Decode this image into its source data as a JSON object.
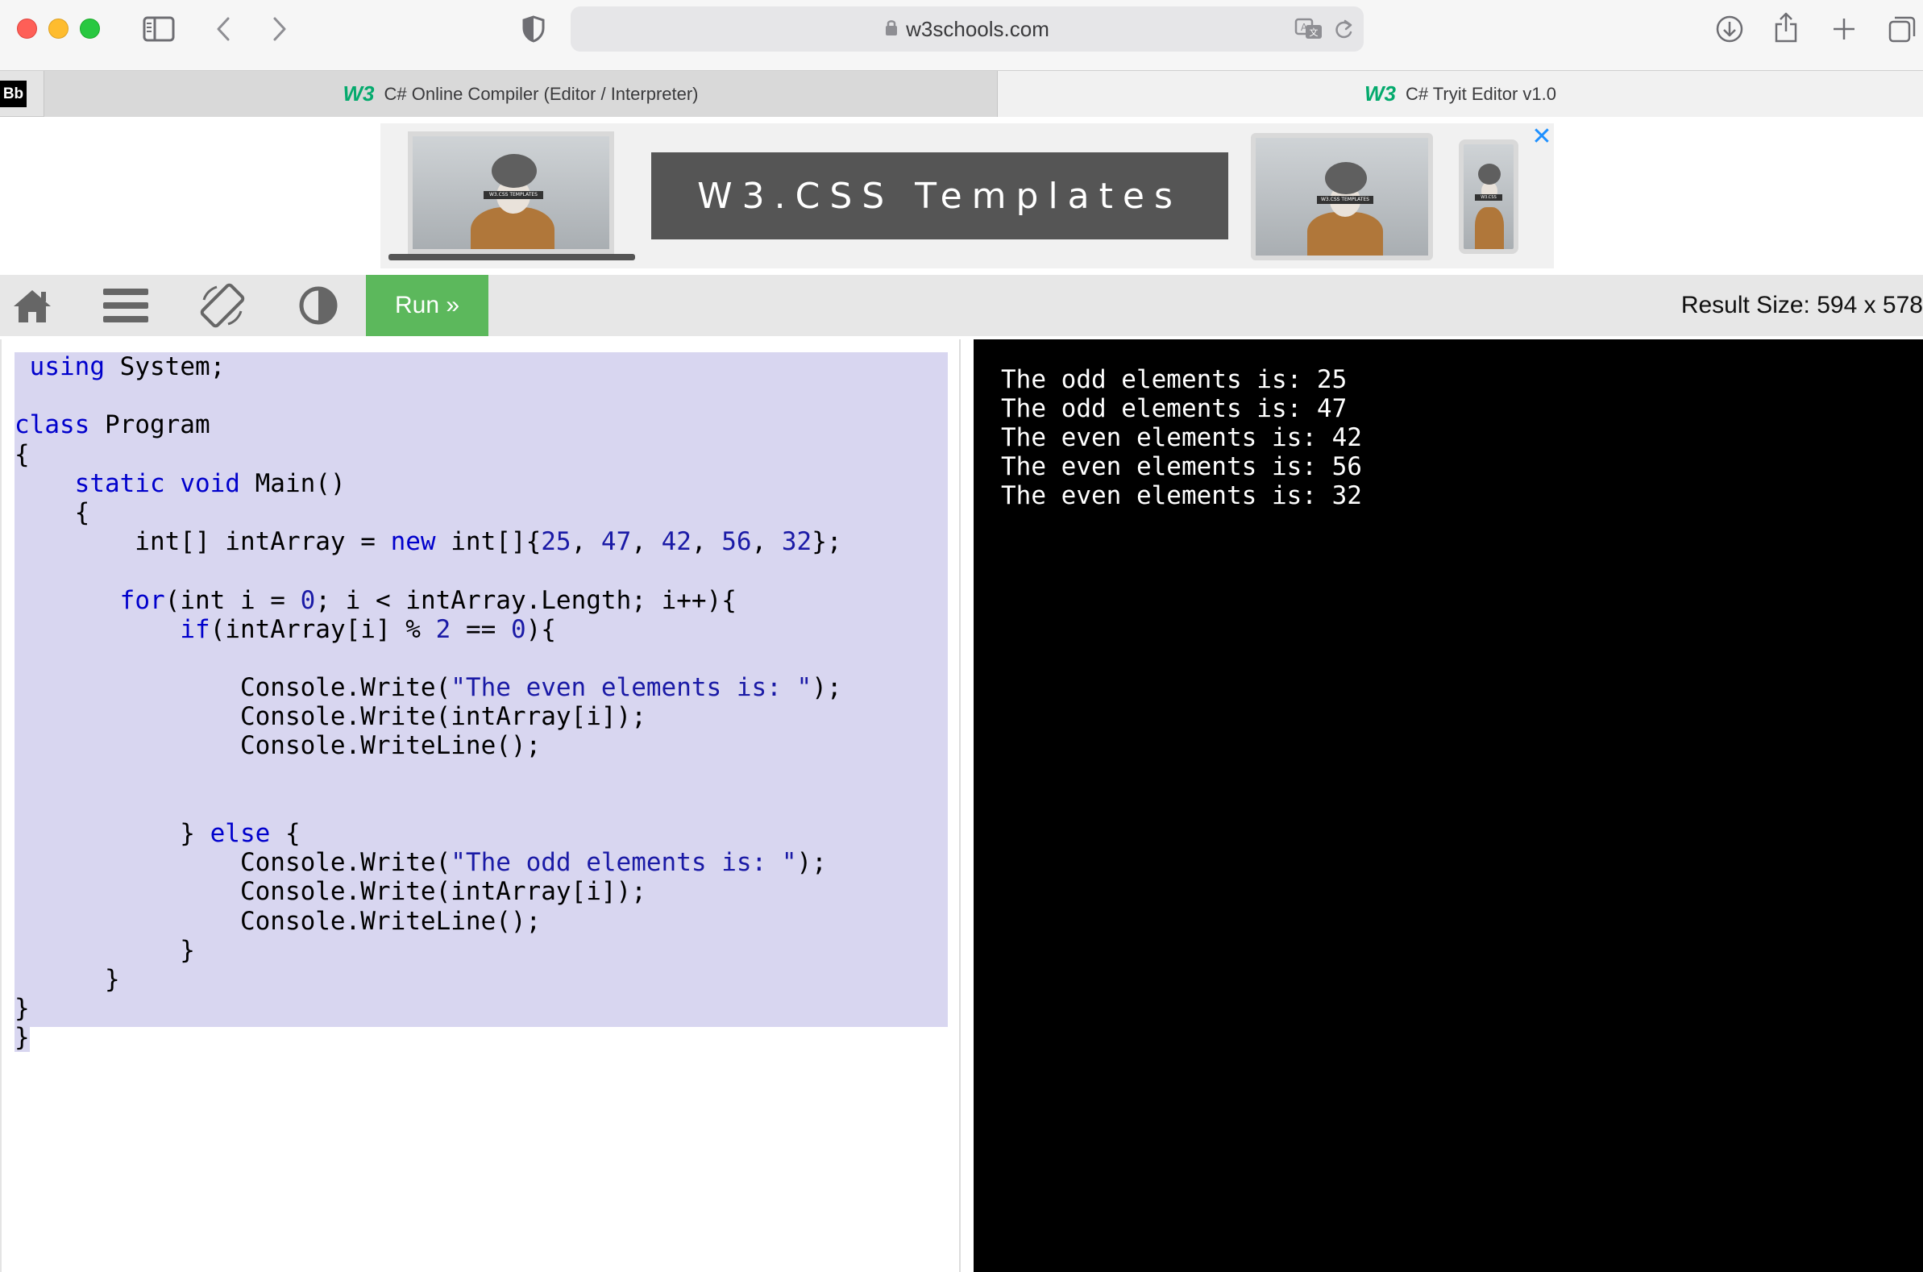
{
  "browser": {
    "url": "w3schools.com",
    "tabs": [
      {
        "label": "C# Online Compiler (Editor / Interpreter)",
        "favicon": "W3"
      },
      {
        "label": "C# Tryit Editor v1.0",
        "favicon": "W3"
      }
    ],
    "pinned_favicon": "Bb",
    "icons": [
      "sidebar-icon",
      "back-icon",
      "forward-icon",
      "shield-icon",
      "lock-icon",
      "translate-icon",
      "reload-icon",
      "download-icon",
      "share-icon",
      "new-tab-icon",
      "tab-overview-icon"
    ]
  },
  "ad": {
    "title": "W3.CSS Templates",
    "close": "✕",
    "device_labels": [
      "W3.CSS TEMPLATES",
      "W3.CSS TEMPLATES",
      "W3.CSS"
    ]
  },
  "toolbar": {
    "run_label": "Run »",
    "result_size": "Result Size: 594 x 578",
    "icons": [
      "home-icon",
      "menu-icon",
      "rotate-icon",
      "theme-toggle-icon"
    ]
  },
  "code": {
    "language": "C#",
    "lines": [
      " using System;",
      "",
      "class Program",
      "{",
      "    static void Main()",
      "    {",
      "        int[] intArray = new int[]{25, 47, 42, 56, 32};",
      "",
      "       for(int i = 0; i < intArray.Length; i++){",
      "           if(intArray[i] % 2 == 0){",
      "",
      "               Console.Write(\"The even elements is: \");",
      "               Console.Write(intArray[i]);",
      "               Console.WriteLine();",
      "",
      "",
      "           } else {",
      "               Console.Write(\"The odd elements is: \");",
      "               Console.Write(intArray[i]);",
      "               Console.WriteLine();",
      "           }",
      "      }",
      "}",
      "}"
    ]
  },
  "output": {
    "lines": [
      "The odd elements is: 25",
      "The odd elements is: 47",
      "The even elements is: 42",
      "The even elements is: 56",
      "The even elements is: 32"
    ]
  },
  "colors": {
    "run_button": "#5cb85c",
    "selection": "#d8d6f0",
    "keyword": "#0000cc",
    "output_bg": "#000000"
  }
}
